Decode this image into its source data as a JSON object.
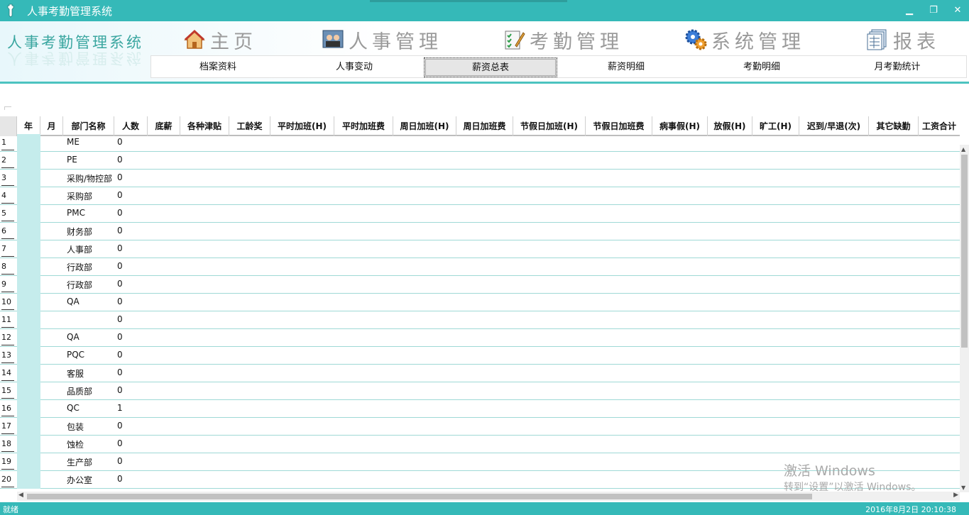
{
  "window": {
    "title": "人事考勤管理系统",
    "controls": {
      "minimize": "▁",
      "restore": "❐",
      "close": "✕"
    }
  },
  "header": {
    "logo_text": "人事考勤管理系统",
    "main_nav": [
      {
        "label": "主页",
        "icon": "home-icon"
      },
      {
        "label": "人事管理",
        "icon": "personnel-icon"
      },
      {
        "label": "考勤管理",
        "icon": "attendance-icon"
      },
      {
        "label": "系统管理",
        "icon": "gear-icon"
      },
      {
        "label": "报表",
        "icon": "report-icon"
      }
    ],
    "sub_tabs": [
      {
        "label": "档案资料"
      },
      {
        "label": "人事变动"
      },
      {
        "label": "薪资总表",
        "active": true
      },
      {
        "label": "薪资明细"
      },
      {
        "label": "考勤明细"
      },
      {
        "label": "月考勤统计"
      }
    ]
  },
  "grid": {
    "columns": [
      "年",
      "月",
      "部门名称",
      "人数",
      "底薪",
      "各种津贴",
      "工龄奖",
      "平时加班(H)",
      "平时加班费",
      "周日加班(H)",
      "周日加班费",
      "节假日加班(H)",
      "节假日加班费",
      "病事假(H)",
      "放假(H)",
      "旷工(H)",
      "迟到/早退(次)",
      "其它缺勤",
      "工资合计"
    ],
    "rows": [
      {
        "num": "1",
        "dept": "ME",
        "count": "0"
      },
      {
        "num": "2",
        "dept": "PE",
        "count": "0"
      },
      {
        "num": "3",
        "dept": "采购/物控部",
        "count": "0"
      },
      {
        "num": "4",
        "dept": "采购部",
        "count": "0"
      },
      {
        "num": "5",
        "dept": "PMC",
        "count": "0"
      },
      {
        "num": "6",
        "dept": "财务部",
        "count": "0"
      },
      {
        "num": "7",
        "dept": "人事部",
        "count": "0"
      },
      {
        "num": "8",
        "dept": "行政部",
        "count": "0"
      },
      {
        "num": "9",
        "dept": "行政部",
        "count": "0"
      },
      {
        "num": "10",
        "dept": "QA",
        "count": "0"
      },
      {
        "num": "11",
        "dept": "",
        "count": "0"
      },
      {
        "num": "12",
        "dept": "QA",
        "count": "0"
      },
      {
        "num": "13",
        "dept": "PQC",
        "count": "0"
      },
      {
        "num": "14",
        "dept": "客服",
        "count": "0"
      },
      {
        "num": "15",
        "dept": "品质部",
        "count": "0"
      },
      {
        "num": "16",
        "dept": "QC",
        "count": "1"
      },
      {
        "num": "17",
        "dept": "包装",
        "count": "0"
      },
      {
        "num": "18",
        "dept": "蚀检",
        "count": "0"
      },
      {
        "num": "19",
        "dept": "生产部",
        "count": "0"
      },
      {
        "num": "20",
        "dept": "办公室",
        "count": "0"
      }
    ]
  },
  "watermark": {
    "line1": "激活 Windows",
    "line2": "转到“设置”以激活 Windows。"
  },
  "statusbar": {
    "left": "就绪",
    "right": "2016年8月2日 20:10:38"
  },
  "colors": {
    "accent": "#35b9b8",
    "grid_line": "#9fd9d6",
    "year_col": "#c5ecec"
  }
}
